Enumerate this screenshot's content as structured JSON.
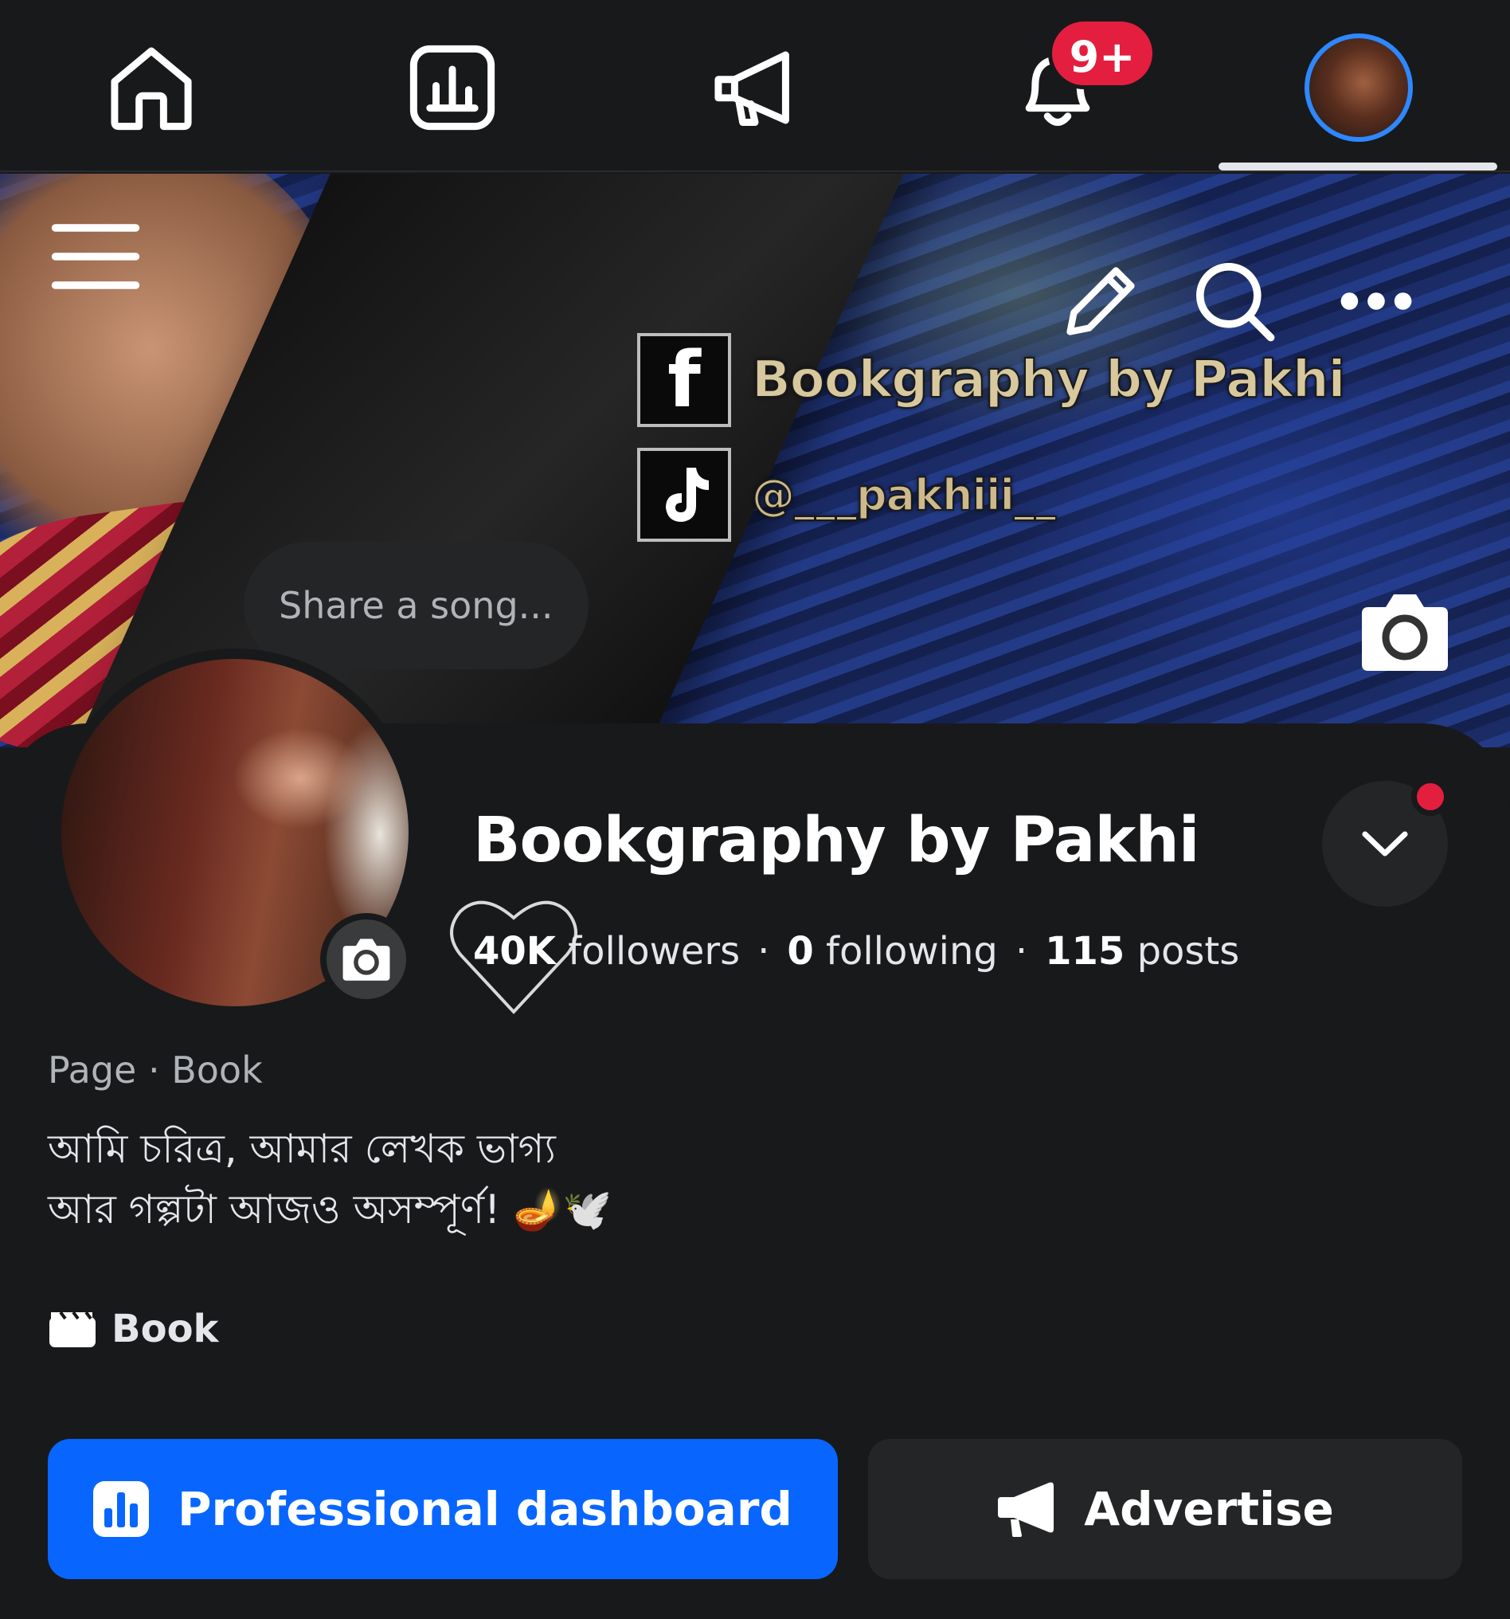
{
  "nav": {
    "notification_badge": "9+",
    "icons": [
      "home-icon",
      "dashboard-icon",
      "megaphone-icon",
      "bell-icon",
      "profile-avatar"
    ]
  },
  "cover": {
    "overlay_title": "Bookgraphy by Pakhi",
    "overlay_handle": "@___pakhiii__",
    "facebook_glyph": "f"
  },
  "song_prompt": "Share a song...",
  "profile": {
    "name": "Bookgraphy by Pakhi",
    "followers_count": "40K",
    "followers_label": "followers",
    "following_count": "0",
    "following_label": "following",
    "posts_count": "115",
    "posts_label": "posts",
    "separator": "·",
    "category_line": "Page · Book",
    "bio": "আমি চরিত্র, আমার লেখক ভাগ্য\n আর গল্পটা আজও অসম্পূর্ণ! 🪔🕊️",
    "category_tag": "Book"
  },
  "buttons": {
    "dashboard_label": "Professional dashboard",
    "advertise_label": "Advertise"
  },
  "colors": {
    "background": "#18191b",
    "primary_blue": "#0866ff",
    "badge_red": "#e41e3f",
    "secondary_button": "#242526"
  }
}
